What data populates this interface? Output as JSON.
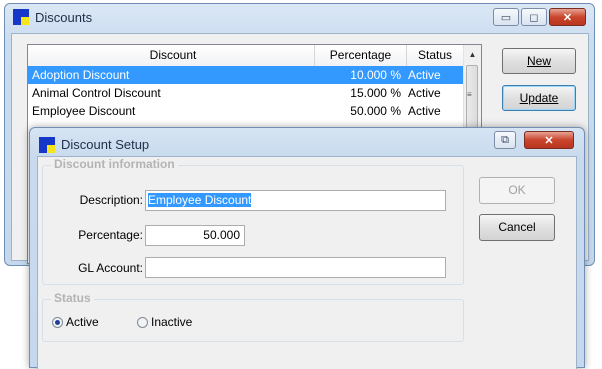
{
  "discounts_window": {
    "title": "Discounts",
    "columns": [
      "Discount",
      "Percentage",
      "Status"
    ],
    "rows": [
      {
        "name": "Adoption Discount",
        "percentage": "10.000 %",
        "status": "Active"
      },
      {
        "name": "Animal Control Discount",
        "percentage": "15.000 %",
        "status": "Active"
      },
      {
        "name": "Employee Discount",
        "percentage": "50.000 %",
        "status": "Active"
      }
    ],
    "buttons": {
      "new": "New",
      "update": "Update"
    },
    "minimize_glyph": "▭",
    "maximize_glyph": "◻",
    "close_glyph": "✕"
  },
  "setup_dialog": {
    "title": "Discount Setup",
    "info_group": "Discount information",
    "description_label": "Description:",
    "description_value": "Employee Discount",
    "percentage_label": "Percentage:",
    "percentage_value": "50.000",
    "gl_label": "GL Account:",
    "gl_value": "",
    "status_group": "Status",
    "radio_active": "Active",
    "radio_inactive": "Inactive",
    "ok": "OK",
    "cancel": "Cancel",
    "restore_glyph": "⧉",
    "close_glyph": "✕"
  },
  "colors": {
    "selection": "#3399ff",
    "title_blue": "#c5d8ee",
    "close_red": "#c9452d"
  }
}
